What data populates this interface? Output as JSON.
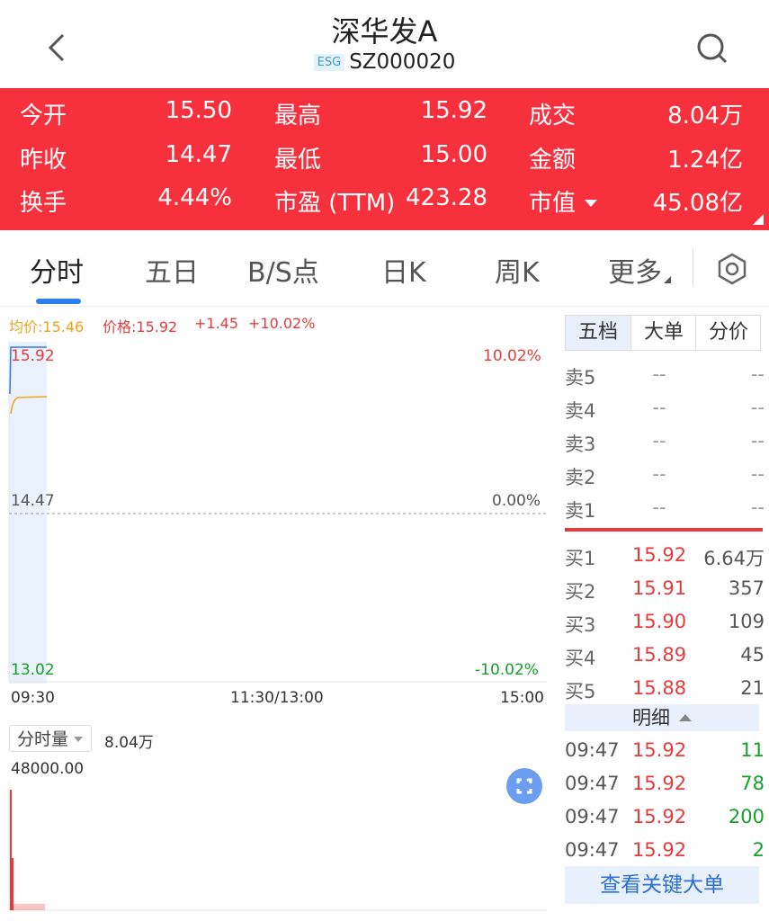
{
  "header": {
    "title": "深华发A",
    "esg_badge": "ESG",
    "code": "SZ000020"
  },
  "quote": {
    "open_label": "今开",
    "open_value": "15.50",
    "high_label": "最高",
    "high_value": "15.92",
    "volume_label": "成交",
    "volume_value": "8.04万",
    "prev_close_label": "昨收",
    "prev_close_value": "14.47",
    "low_label": "最低",
    "low_value": "15.00",
    "amount_label": "金额",
    "amount_value": "1.24亿",
    "turnover_label": "换手",
    "turnover_value": "4.44%",
    "pe_label": "市盈 (TTM)",
    "pe_value": "423.28",
    "mktcap_label": "市值",
    "mktcap_value": "45.08亿",
    "bg_color": "#f7303e"
  },
  "tabs": [
    {
      "label": "分时",
      "active": true
    },
    {
      "label": "五日"
    },
    {
      "label": "B/S点"
    },
    {
      "label": "日K"
    },
    {
      "label": "周K"
    },
    {
      "label": "更多"
    }
  ],
  "chart": {
    "avg_label": "均价:15.46",
    "price_label": "价格:15.92",
    "change": "+1.45",
    "change_pct": "+10.02%",
    "y_top": "15.92",
    "y_mid": "14.47",
    "y_bottom": "13.02",
    "pct_top": "10.02%",
    "pct_mid": "0.00%",
    "pct_bottom": "-10.02%",
    "time_start": "09:30",
    "time_mid": "11:30/13:00",
    "time_end": "15:00",
    "volume_selector": "分时量",
    "volume_total": "8.04万",
    "volume_max": "48000.00"
  },
  "order_book": {
    "tabs": [
      "五档",
      "大单",
      "分价"
    ],
    "sell": [
      {
        "label": "卖5",
        "price": "--",
        "vol": "--"
      },
      {
        "label": "卖4",
        "price": "--",
        "vol": "--"
      },
      {
        "label": "卖3",
        "price": "--",
        "vol": "--"
      },
      {
        "label": "卖2",
        "price": "--",
        "vol": "--"
      },
      {
        "label": "卖1",
        "price": "--",
        "vol": "--"
      }
    ],
    "buy": [
      {
        "label": "买1",
        "price": "15.92",
        "vol": "6.64万"
      },
      {
        "label": "买2",
        "price": "15.91",
        "vol": "357"
      },
      {
        "label": "买3",
        "price": "15.90",
        "vol": "109"
      },
      {
        "label": "买4",
        "price": "15.89",
        "vol": "45"
      },
      {
        "label": "买5",
        "price": "15.88",
        "vol": "21"
      }
    ],
    "detail_label": "明细",
    "details": [
      {
        "time": "09:47",
        "price": "15.92",
        "vol": "11"
      },
      {
        "time": "09:47",
        "price": "15.92",
        "vol": "78"
      },
      {
        "time": "09:47",
        "price": "15.92",
        "vol": "200"
      },
      {
        "time": "09:47",
        "price": "15.92",
        "vol": "2"
      }
    ],
    "big_order_button": "查看关键大单"
  }
}
